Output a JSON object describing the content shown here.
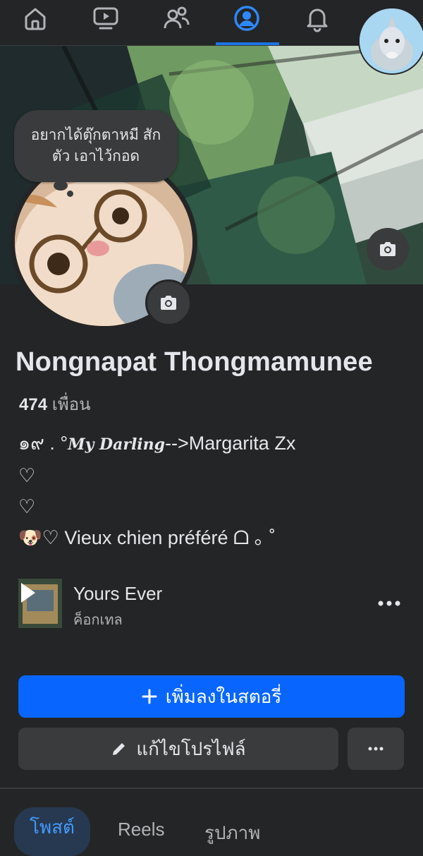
{
  "nav": {
    "items": [
      {
        "name": "home"
      },
      {
        "name": "watch"
      },
      {
        "name": "friends"
      },
      {
        "name": "profile",
        "active": true
      },
      {
        "name": "notifications"
      },
      {
        "name": "menu"
      }
    ],
    "accent": "#1b74e4"
  },
  "note": {
    "text": "อยากได้ตุ๊กตาหมี สักตัว เอาไว้กอด"
  },
  "profile": {
    "name": "Nongnapat Thongmamunee",
    "friends_count": "474",
    "friends_label": "เพื่อน"
  },
  "bio": {
    "line1_prefix": "๑๙ .  °",
    "line1_script": "My Darling",
    "line1_suffix": "-->Margarita  Zx",
    "line2": "♡",
    "line3": "♡",
    "line4": "🐶♡ Vieux chien préféré ᗝ ｡ ˚"
  },
  "music": {
    "title": "Yours Ever",
    "artist": "ค็อกเทล"
  },
  "actions": {
    "add_story": "เพิ่มลงในสตอรี่",
    "edit_profile": "แก้ไขโปรไฟล์",
    "primary_color": "#0866ff"
  },
  "tabs": [
    {
      "label": "โพสต์",
      "active": true
    },
    {
      "label": "Reels"
    },
    {
      "label": "รูปภาพ"
    }
  ]
}
